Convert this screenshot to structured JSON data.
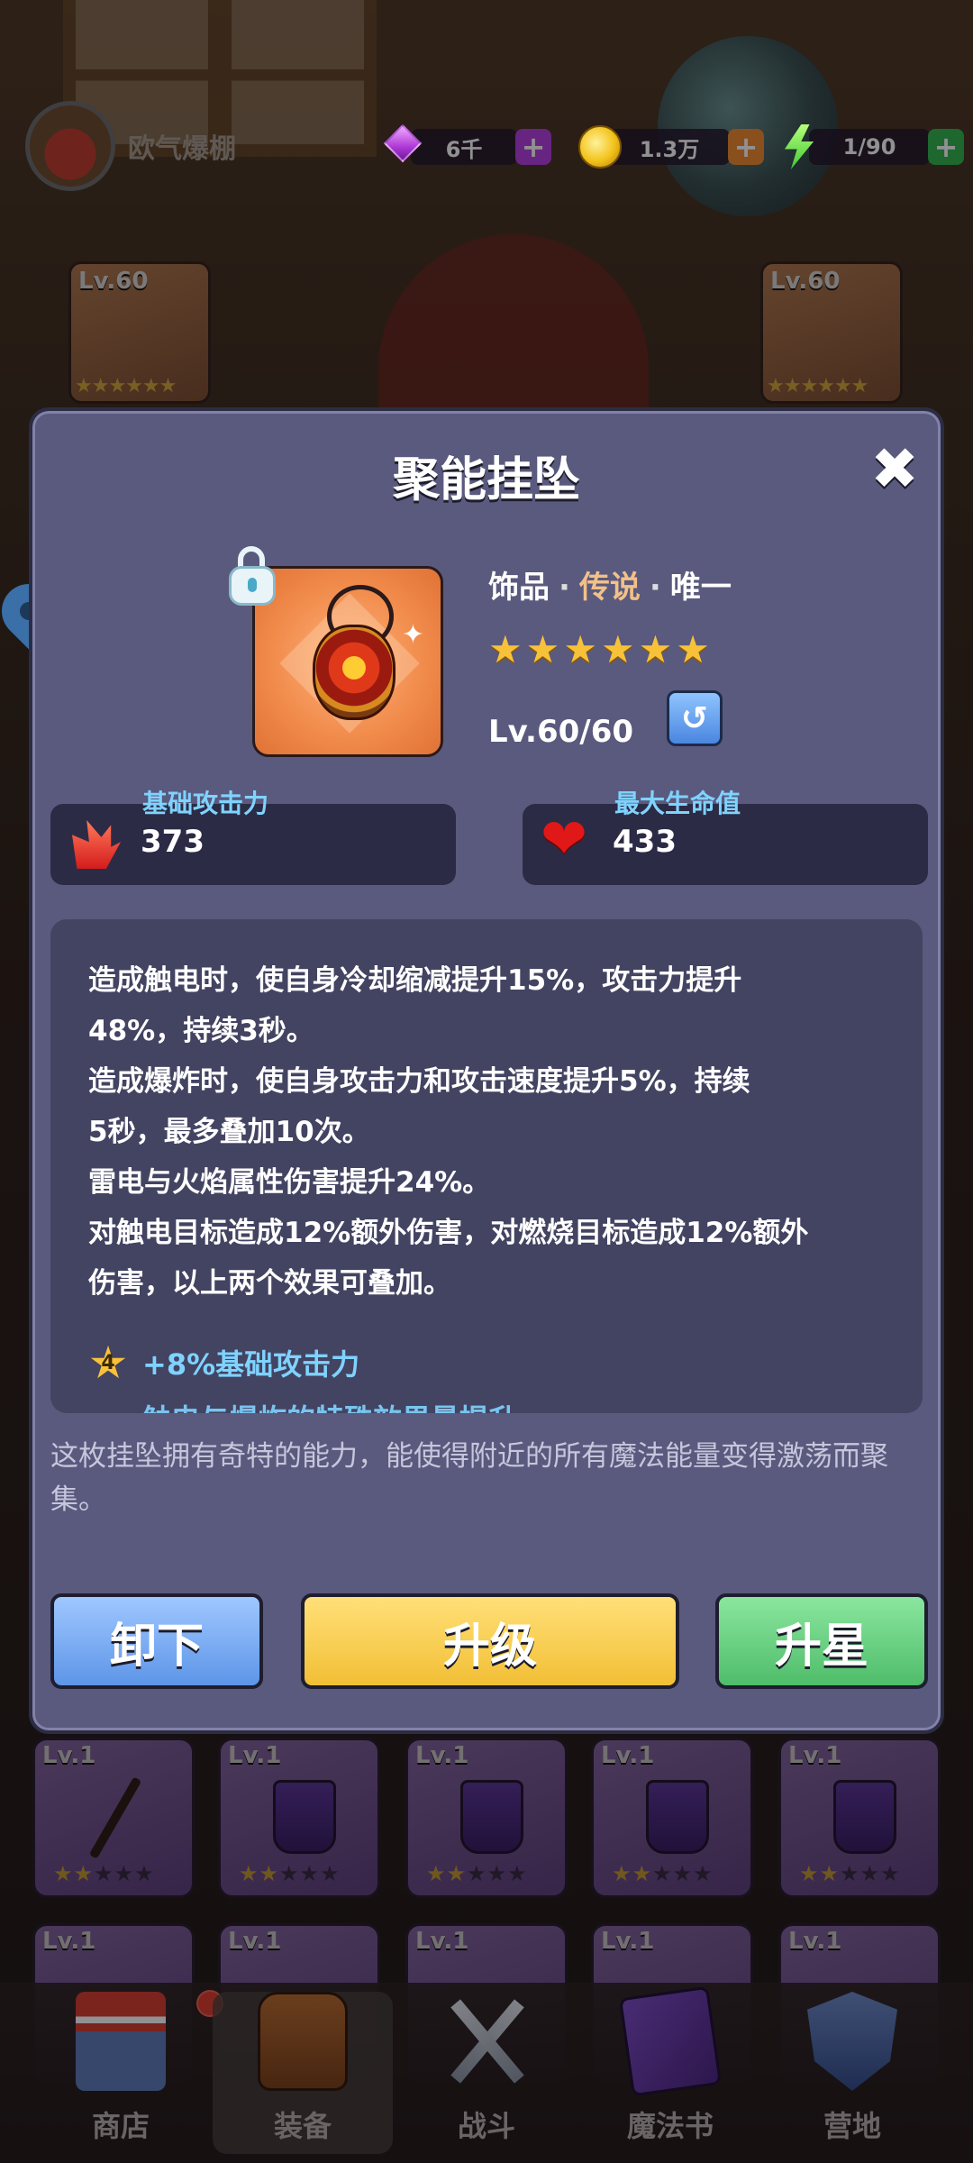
{
  "top_bar": {
    "profile_name": "欧气爆棚",
    "resources": [
      {
        "icon": "gem-icon",
        "value": "6千",
        "plus_color": "#b23de0"
      },
      {
        "icon": "coin-icon",
        "value": "1.3万",
        "plus_color": "#f08a2a"
      },
      {
        "icon": "energy-icon",
        "value": "1/90",
        "plus_color": "#2fb54a"
      }
    ],
    "plus_symbol": "+"
  },
  "equipped": [
    {
      "level": "Lv.60",
      "stars": "★★★★★★"
    },
    {
      "level": "Lv.60",
      "stars": "★★★★★★"
    }
  ],
  "modal": {
    "title": "聚能挂坠",
    "close_symbol": "✖",
    "item_type": "饰品",
    "item_rarity": "传说",
    "item_unique": "唯一",
    "separator": "·",
    "star_count": 6,
    "level_text": "Lv.60/60",
    "reset_symbol": "↺",
    "stats": {
      "atk_label": "基础攻击力",
      "atk_value": "373",
      "hp_label": "最大生命值",
      "hp_value": "433"
    },
    "description_lines": [
      "造成触电时，使自身冷却缩减提升15%，攻击力提升",
      "48%，持续3秒。",
      "造成爆炸时，使自身攻击力和攻击速度提升5%，持续",
      "5秒，最多叠加10次。",
      "雷电与火焰属性伤害提升24%。",
      "对触电目标造成12%额外伤害，对燃烧目标造成12%额外",
      "伤害，以上两个效果可叠加。"
    ],
    "bonus_star_number": "4",
    "bonus_text": "+8%基础攻击力",
    "bonus_cut_text": "触电与爆炸的特殊效果量提升",
    "flavor_text": "这枚挂坠拥有奇特的能力，能使得附近的所有魔法能量变得激荡而聚集。",
    "buttons": {
      "unequip": "卸下",
      "upgrade": "升级",
      "star_up": "升星"
    }
  },
  "inventory": {
    "level_label": "Lv.1",
    "stars_filled": "★★",
    "stars_empty": "★★★"
  },
  "bottom_nav": [
    {
      "label": "商店",
      "icon": "shop-icon"
    },
    {
      "label": "装备",
      "icon": "backpack-icon"
    },
    {
      "label": "战斗",
      "icon": "crossed-swords-icon"
    },
    {
      "label": "魔法书",
      "icon": "spellbook-icon"
    },
    {
      "label": "营地",
      "icon": "shield-icon"
    }
  ]
}
